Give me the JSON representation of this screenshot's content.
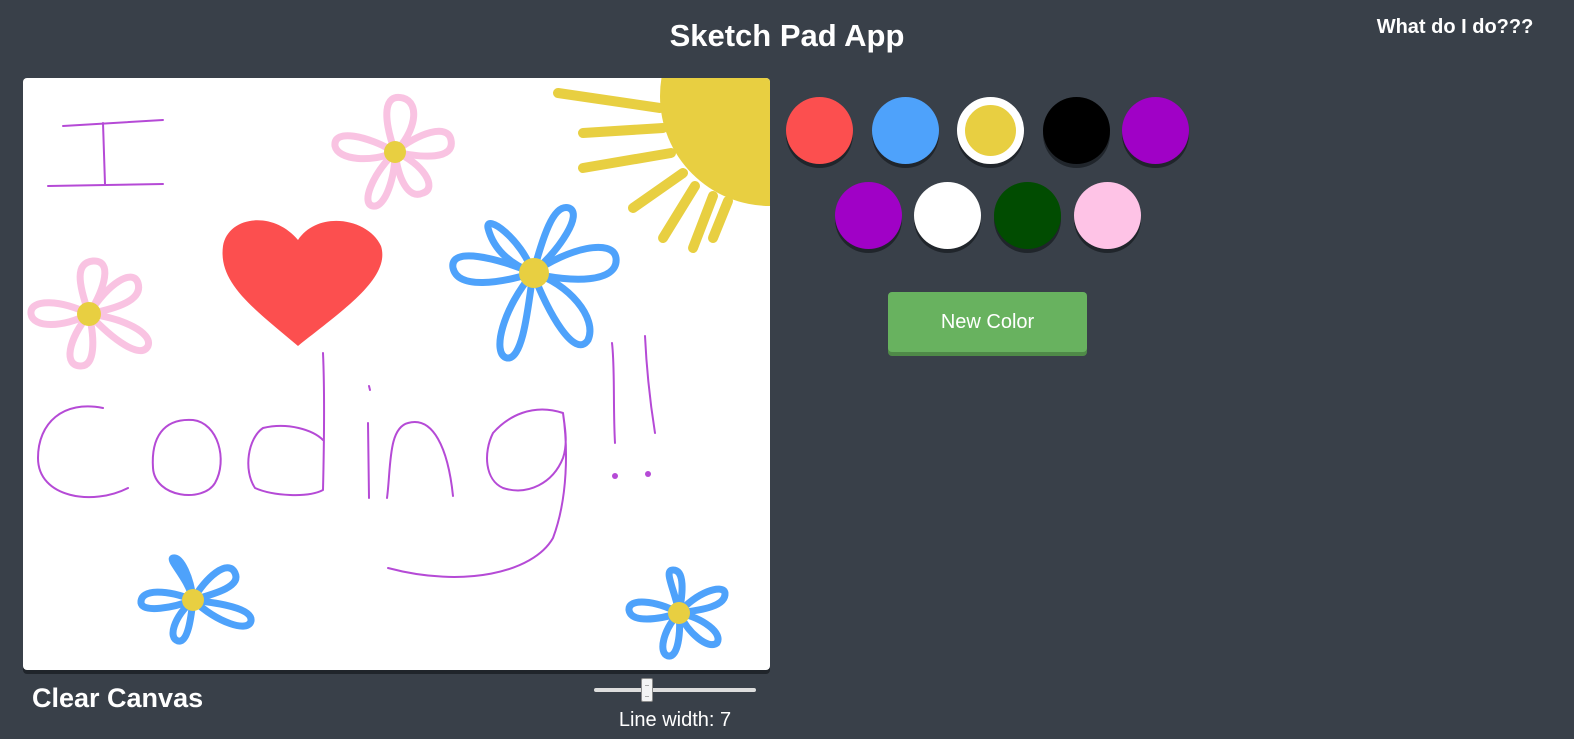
{
  "header": {
    "title": "Sketch Pad App",
    "help_link": "What do I do???"
  },
  "controls": {
    "clear_label": "Clear Canvas",
    "line_width_label": "Line width:",
    "line_width_value": "7",
    "line_width_min": 1,
    "line_width_max": 20,
    "new_color_label": "New Color"
  },
  "palette": {
    "selected_index": 2,
    "colors": [
      "#fc4f4f",
      "#4ea2fb",
      "#e8cf41",
      "#000000",
      "#a001c6",
      "#a001c6",
      "#ffffff",
      "#014c01",
      "#fec3e6"
    ]
  },
  "drawing": {
    "colors": {
      "purple": "#b54ad6",
      "pink": "#f9c3e2",
      "yellow": "#e8cf41",
      "blue": "#4ea2fb",
      "red": "#fc4f4f"
    }
  }
}
